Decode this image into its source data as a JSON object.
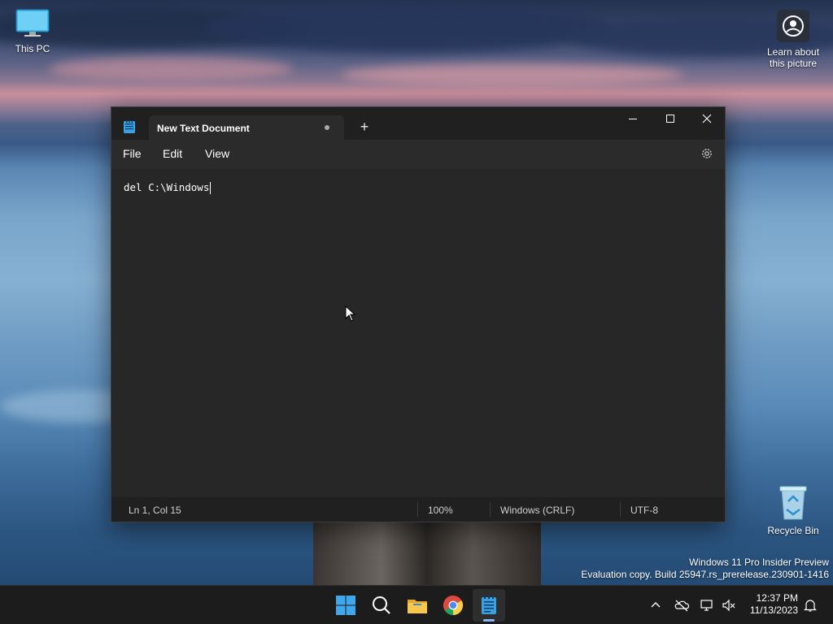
{
  "desktop": {
    "icons": [
      {
        "label": "This PC"
      },
      {
        "label": "Learn about this picture"
      },
      {
        "label": "Recycle Bin"
      }
    ],
    "watermark": {
      "line1": "Windows 11 Pro Insider Preview",
      "line2": "Evaluation copy. Build 25947.rs_prerelease.230901-1416"
    }
  },
  "notepad": {
    "tab_title": "New Text Document",
    "new_tab_symbol": "+",
    "menu": [
      "File",
      "Edit",
      "View"
    ],
    "content": "del C:\\Windows",
    "status": {
      "position": "Ln 1, Col 15",
      "zoom": "100%",
      "line_ending": "Windows (CRLF)",
      "encoding": "UTF-8"
    },
    "window_controls": [
      "minimize",
      "maximize",
      "close"
    ]
  },
  "taskbar": {
    "apps": [
      "start-icon",
      "search-icon",
      "file-explorer-icon",
      "chrome-icon",
      "notepad-icon"
    ],
    "tray": [
      "chevron-up-icon",
      "onedrive-icon",
      "network-icon",
      "volume-mute-icon",
      "notification-bell-icon"
    ],
    "time": "12:37 PM",
    "date": "11/13/2023"
  }
}
